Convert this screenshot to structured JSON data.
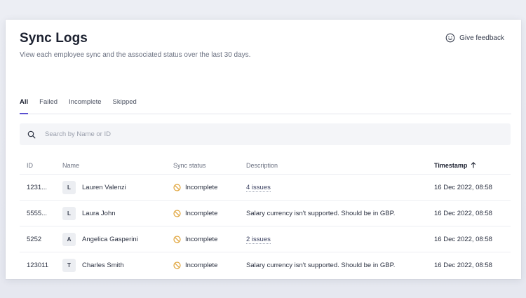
{
  "header": {
    "title": "Sync Logs",
    "subtitle": "View each employee sync and the associated status over the last 30 days.",
    "feedback_label": "Give feedback"
  },
  "tabs": [
    {
      "label": "All",
      "active": true
    },
    {
      "label": "Failed",
      "active": false
    },
    {
      "label": "Incomplete",
      "active": false
    },
    {
      "label": "Skipped",
      "active": false
    }
  ],
  "search": {
    "placeholder": "Search by Name or ID",
    "value": ""
  },
  "table": {
    "columns": {
      "id": "ID",
      "name": "Name",
      "status": "Sync status",
      "description": "Description",
      "timestamp": "Timestamp"
    },
    "sort_icon": "arrow-up-icon",
    "rows": [
      {
        "id": "1231...",
        "initial": "L",
        "name": "Lauren Valenzi",
        "status": "Incomplete",
        "description": "4 issues",
        "description_is_link": true,
        "timestamp": "16 Dec 2022, 08:58"
      },
      {
        "id": "5555...",
        "initial": "L",
        "name": "Laura John",
        "status": "Incomplete",
        "description": "Salary currency isn't supported. Should be in GBP.",
        "description_is_link": false,
        "timestamp": "16 Dec 2022, 08:58"
      },
      {
        "id": "5252",
        "initial": "A",
        "name": "Angelica Gasperini",
        "status": "Incomplete",
        "description": "2 issues",
        "description_is_link": true,
        "timestamp": "16 Dec 2022, 08:58"
      },
      {
        "id": "123011",
        "initial": "T",
        "name": "Charles Smith",
        "status": "Incomplete",
        "description": "Salary currency isn't supported. Should be in GBP.",
        "description_is_link": false,
        "timestamp": "16 Dec 2022, 08:58"
      }
    ]
  },
  "colors": {
    "accent": "#5a4fd0",
    "status_incomplete": "#e0a43a"
  }
}
